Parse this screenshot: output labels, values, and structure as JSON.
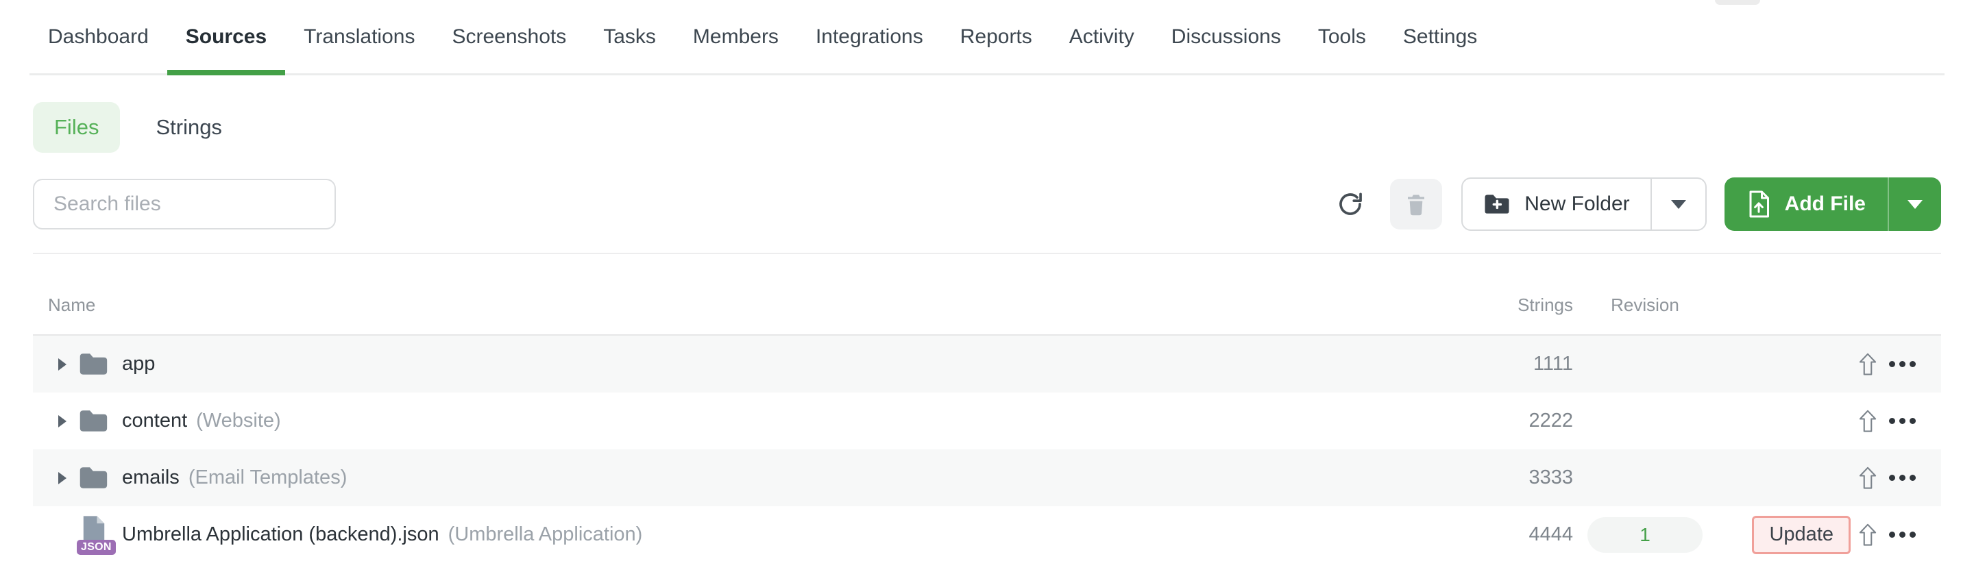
{
  "nav": {
    "items": [
      {
        "label": "Dashboard",
        "active": false
      },
      {
        "label": "Sources",
        "active": true
      },
      {
        "label": "Translations",
        "active": false
      },
      {
        "label": "Screenshots",
        "active": false
      },
      {
        "label": "Tasks",
        "active": false
      },
      {
        "label": "Members",
        "active": false
      },
      {
        "label": "Integrations",
        "active": false
      },
      {
        "label": "Reports",
        "active": false
      },
      {
        "label": "Activity",
        "active": false
      },
      {
        "label": "Discussions",
        "active": false
      },
      {
        "label": "Tools",
        "active": false
      },
      {
        "label": "Settings",
        "active": false
      }
    ]
  },
  "view_toggle": {
    "files_label": "Files",
    "strings_label": "Strings",
    "selected": "Files"
  },
  "toolbar": {
    "search_placeholder": "Search files",
    "refresh_icon": "refresh",
    "delete_icon": "trash",
    "new_folder_label": "New Folder",
    "add_file_label": "Add File"
  },
  "table": {
    "headers": {
      "name": "Name",
      "strings": "Strings",
      "revision": "Revision"
    },
    "rows": [
      {
        "type": "folder",
        "name": "app",
        "context": "",
        "strings": "1111",
        "revision": "",
        "update_label": ""
      },
      {
        "type": "folder",
        "name": "content",
        "context": "(Website)",
        "strings": "2222",
        "revision": "",
        "update_label": ""
      },
      {
        "type": "folder",
        "name": "emails",
        "context": "(Email Templates)",
        "strings": "3333",
        "revision": "",
        "update_label": ""
      },
      {
        "type": "file",
        "file_type_badge": "JSON",
        "name": "Umbrella Application (backend).json",
        "context": "(Umbrella Application)",
        "strings": "4444",
        "revision": "1",
        "update_label": "Update"
      }
    ]
  },
  "colors": {
    "accent_green": "#43a047",
    "files_pill_bg": "#eaf5ea",
    "files_pill_text": "#55b158",
    "row_stripe": "#f7f8f8",
    "update_button_bg": "#fdeeee",
    "update_button_border": "#f0a09a",
    "revision_badge_bg": "#f3f5f4",
    "revision_badge_text": "#43a047",
    "json_badge_purple": "#9c6eb4",
    "file_icon_gray": "#8e9cab",
    "folder_icon_gray": "#7e8891"
  }
}
